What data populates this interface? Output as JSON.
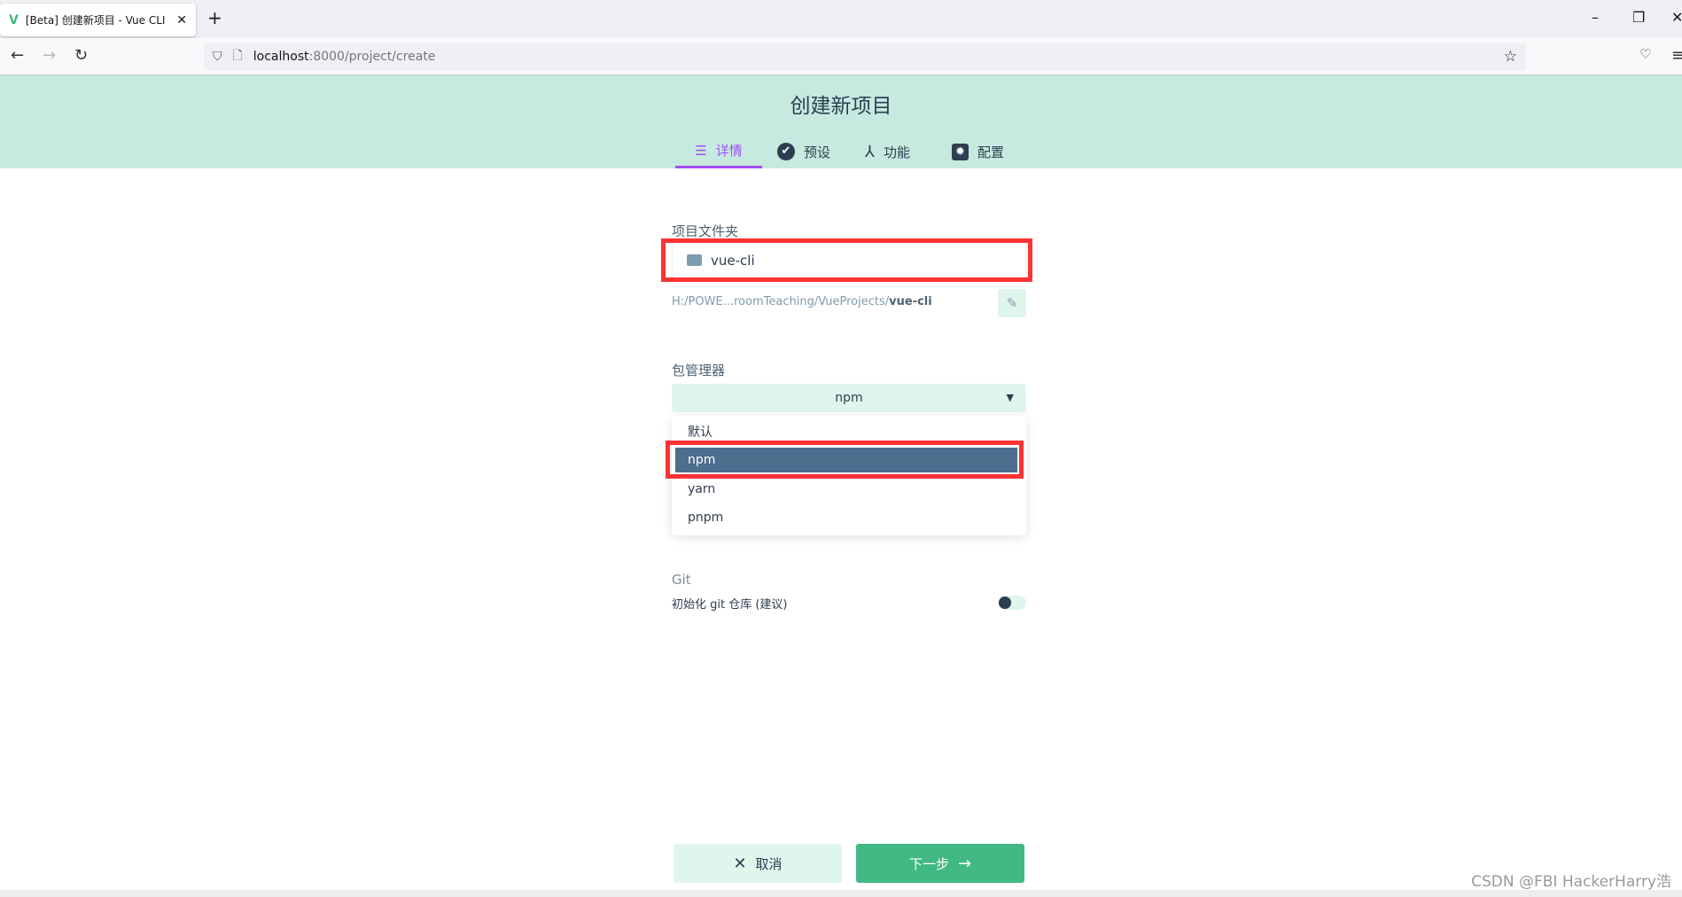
{
  "browser": {
    "tab_title": "[Beta] 创建新项目 - Vue CLI",
    "url_host": "localhost",
    "url_rest": ":8000/project/create"
  },
  "page": {
    "title": "创建新项目",
    "tabs": [
      {
        "label": "详情",
        "icon": "list-icon",
        "active": true
      },
      {
        "label": "预设",
        "icon": "check-circle-icon"
      },
      {
        "label": "功能",
        "icon": "fork-icon"
      },
      {
        "label": "配置",
        "icon": "gear-icon"
      }
    ]
  },
  "form": {
    "folder_label": "项目文件夹",
    "folder_value": "vue-cli",
    "path_prefix": "H:/POWE...roomTeaching/VueProjects/",
    "path_name": "vue-cli",
    "pm_label": "包管理器",
    "pm_value": "npm",
    "pm_options": [
      "默认",
      "npm",
      "yarn",
      "pnpm"
    ],
    "git_label": "Git",
    "git_init_label": "初始化 git 仓库 (建议)",
    "git_init_enabled": false
  },
  "actions": {
    "cancel": "取消",
    "next": "下一步"
  },
  "watermark": "CSDN @FBI HackerHarry浩",
  "colors": {
    "header": "#c6eadf",
    "accent": "#a44cf6",
    "primary": "#42b983",
    "highlight": "#f33333"
  }
}
